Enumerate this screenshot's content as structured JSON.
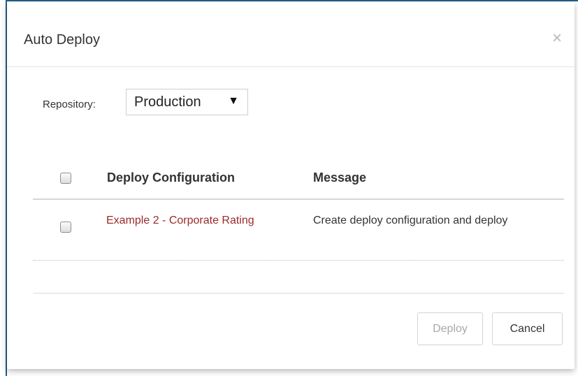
{
  "dialog": {
    "title": "Auto Deploy",
    "close_symbol": "×"
  },
  "repository": {
    "label": "Repository:",
    "selected": "Production",
    "arrow": "▼"
  },
  "table": {
    "headers": {
      "select_all_checked": false,
      "deploy_configuration": "Deploy Configuration",
      "message": "Message"
    },
    "rows": [
      {
        "checked": false,
        "configuration": "Example 2 - Corporate Rating",
        "message": "Create deploy configuration and deploy"
      }
    ]
  },
  "footer": {
    "deploy_label": "Deploy",
    "deploy_disabled": true,
    "cancel_label": "Cancel"
  },
  "colors": {
    "link": "#9a2a2a",
    "frame_accent": "#1f5f8b",
    "disabled_text": "#a8a8a8"
  },
  "icons": {
    "close": "close-icon",
    "select_arrow": "caret-down-icon"
  }
}
